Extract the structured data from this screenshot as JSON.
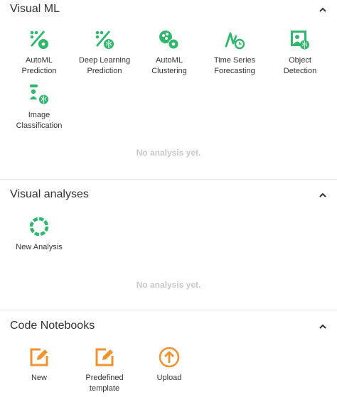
{
  "visual_ml": {
    "title": "Visual ML",
    "tiles": [
      {
        "label": "AutoML\nPrediction",
        "icon": "automl-prediction-icon"
      },
      {
        "label": "Deep Learning\nPrediction",
        "icon": "deep-learning-prediction-icon"
      },
      {
        "label": "AutoML\nClustering",
        "icon": "automl-clustering-icon"
      },
      {
        "label": "Time Series\nForecasting",
        "icon": "time-series-forecasting-icon"
      },
      {
        "label": "Object\nDetection",
        "icon": "object-detection-icon"
      },
      {
        "label": "Image\nClassification",
        "icon": "image-classification-icon"
      }
    ],
    "empty": "No analysis yet."
  },
  "visual_analyses": {
    "title": "Visual analyses",
    "tiles": [
      {
        "label": "New Analysis",
        "icon": "new-analysis-icon"
      }
    ],
    "empty": "No analysis yet."
  },
  "code_notebooks": {
    "title": "Code Notebooks",
    "tiles": [
      {
        "label": "New",
        "icon": "edit-icon"
      },
      {
        "label": "Predefined\ntemplate",
        "icon": "edit-icon"
      },
      {
        "label": "Upload",
        "icon": "upload-icon"
      }
    ]
  },
  "colors": {
    "green": "#2fb86b",
    "orange": "#f0922f",
    "empty_text": "#c8c8c8"
  }
}
